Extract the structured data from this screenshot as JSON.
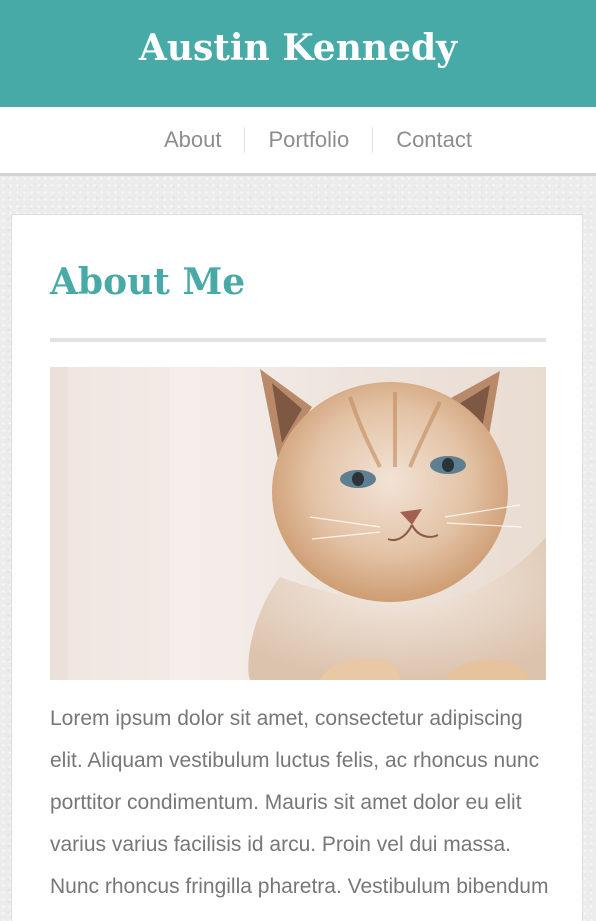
{
  "header": {
    "site_title": "Austin Kennedy"
  },
  "nav": {
    "items": [
      {
        "label": "About"
      },
      {
        "label": "Portfolio"
      },
      {
        "label": "Contact"
      }
    ]
  },
  "main": {
    "heading": "About Me",
    "image": {
      "subject": "cat-photo"
    },
    "body_text": "Lorem ipsum dolor sit amet, consectetur adipiscing elit. Aliquam vestibulum luctus felis, ac rhoncus nunc porttitor condimentum. Mauris sit amet dolor eu elit varius varius facilisis id arcu. Proin vel dui massa. Nunc rhoncus fringilla pharetra. Vestibulum bibendum consectetur"
  },
  "colors": {
    "accent": "#48aaa6",
    "nav_text": "#8d8d8d",
    "body_text": "#777777",
    "page_background": "#ececec"
  }
}
